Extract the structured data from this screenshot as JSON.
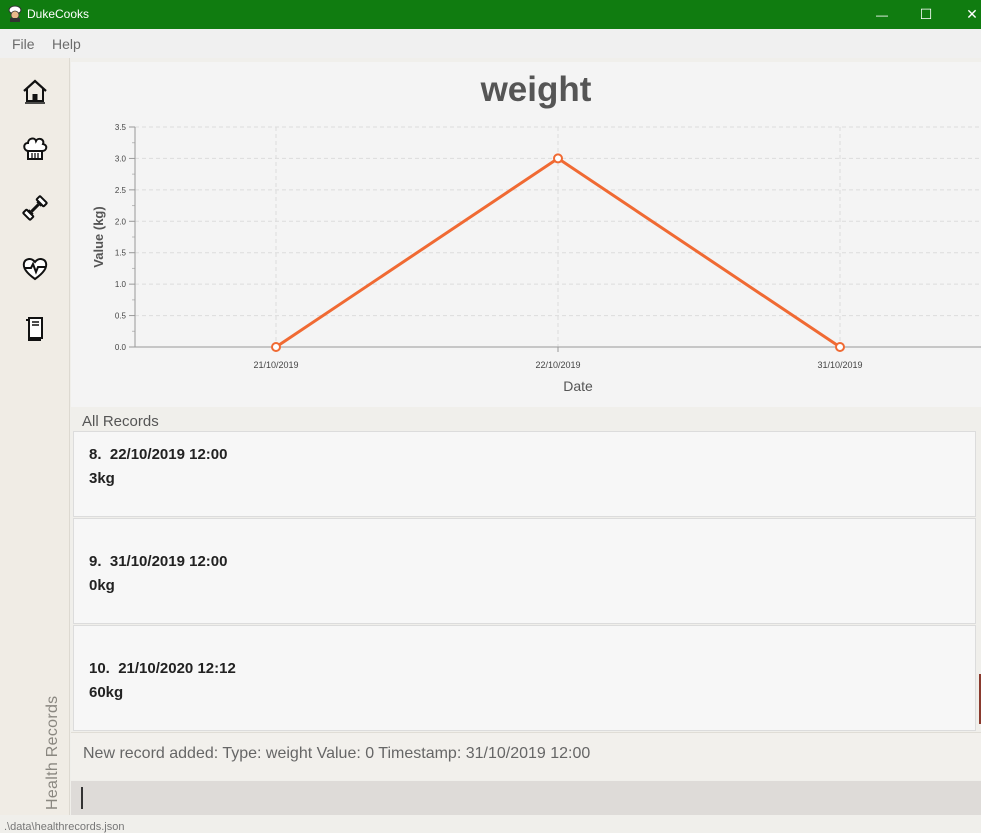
{
  "window": {
    "title": "DukeCooks",
    "minimize_glyph": "—",
    "maximize_glyph": "☐",
    "close_glyph": "✕"
  },
  "menu": {
    "items": [
      "File",
      "Help"
    ]
  },
  "sidebar": {
    "items": [
      {
        "icon": "home-icon"
      },
      {
        "icon": "chef-hat-icon"
      },
      {
        "icon": "dumbbell-icon"
      },
      {
        "icon": "heartbeat-icon"
      },
      {
        "icon": "book-icon"
      }
    ],
    "section_label": "Health Records"
  },
  "chart_data": {
    "type": "line",
    "title": "weight",
    "xlabel": "Date",
    "ylabel": "Value (kg)",
    "categories": [
      "21/10/2019",
      "22/10/2019",
      "31/10/2019"
    ],
    "values": [
      0,
      3,
      0
    ],
    "ylim": [
      0,
      3.5
    ],
    "yticks": [
      "0.0",
      "0.5",
      "1.0",
      "1.5",
      "2.0",
      "2.5",
      "3.0",
      "3.5"
    ],
    "grid": true,
    "color": "#f06a33"
  },
  "records": {
    "header": "All Records",
    "items": [
      {
        "index": "8.",
        "timestamp": "22/10/2019 12:00",
        "value": "3kg"
      },
      {
        "index": "9.",
        "timestamp": "31/10/2019 12:00",
        "value": "0kg"
      },
      {
        "index": "10.",
        "timestamp": "21/10/2020 12:12",
        "value": "60kg"
      }
    ]
  },
  "status": {
    "message": "New record added: Type: weight Value: 0 Timestamp: 31/10/2019 12:00"
  },
  "command": {
    "value": ""
  },
  "footer": {
    "path": ".\\data\\healthrecords.json"
  }
}
